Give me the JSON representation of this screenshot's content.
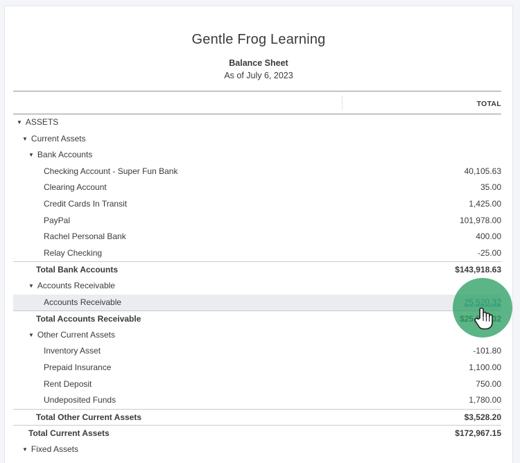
{
  "report": {
    "company": "Gentle Frog Learning",
    "title": "Balance Sheet",
    "date": "As of July 6, 2023",
    "column_header": "TOTAL"
  },
  "rows": [
    {
      "label": "ASSETS",
      "amount": "",
      "level": 0,
      "caret": true,
      "kind": "section"
    },
    {
      "label": "Current Assets",
      "amount": "",
      "level": 1,
      "caret": true,
      "kind": "section"
    },
    {
      "label": "Bank Accounts",
      "amount": "",
      "level": 2,
      "caret": true,
      "kind": "section"
    },
    {
      "label": "Checking Account - Super Fun Bank",
      "amount": "40,105.63",
      "level": 3,
      "kind": "line"
    },
    {
      "label": "Clearing Account",
      "amount": "35.00",
      "level": 3,
      "kind": "line"
    },
    {
      "label": "Credit Cards In Transit",
      "amount": "1,425.00",
      "level": 3,
      "kind": "line"
    },
    {
      "label": "PayPal",
      "amount": "101,978.00",
      "level": 3,
      "kind": "line"
    },
    {
      "label": "Rachel Personal Bank",
      "amount": "400.00",
      "level": 3,
      "kind": "line"
    },
    {
      "label": "Relay Checking",
      "amount": "-25.00",
      "level": 3,
      "kind": "line"
    },
    {
      "label": "Total Bank Accounts",
      "amount": "$143,918.63",
      "level": 3,
      "kind": "total"
    },
    {
      "label": "Accounts Receivable",
      "amount": "",
      "level": 2,
      "caret": true,
      "kind": "section"
    },
    {
      "label": "Accounts Receivable",
      "amount": "25,520.32",
      "level": 3,
      "kind": "line",
      "highlight": true
    },
    {
      "label": "Total Accounts Receivable",
      "amount": "$25,520.32",
      "level": 3,
      "kind": "total"
    },
    {
      "label": "Other Current Assets",
      "amount": "",
      "level": 2,
      "caret": true,
      "kind": "section"
    },
    {
      "label": "Inventory Asset",
      "amount": "-101.80",
      "level": 3,
      "kind": "line"
    },
    {
      "label": "Prepaid Insurance",
      "amount": "1,100.00",
      "level": 3,
      "kind": "line"
    },
    {
      "label": "Rent Deposit",
      "amount": "750.00",
      "level": 3,
      "kind": "line"
    },
    {
      "label": "Undeposited Funds",
      "amount": "1,780.00",
      "level": 3,
      "kind": "line"
    },
    {
      "label": "Total Other Current Assets",
      "amount": "$3,528.20",
      "level": 3,
      "kind": "total"
    },
    {
      "label": "Total Current Assets",
      "amount": "$172,967.15",
      "level": 2,
      "kind": "total-strong"
    },
    {
      "label": "Fixed Assets",
      "amount": "",
      "level": 1,
      "caret": true,
      "kind": "section"
    }
  ],
  "icons": {
    "expand": "caret-down-icon",
    "cursor": "hand-pointer-icon"
  },
  "colors": {
    "link": "#0077c5",
    "cursor_ring": "#2ea064",
    "row_highlight": "#ebecef"
  }
}
